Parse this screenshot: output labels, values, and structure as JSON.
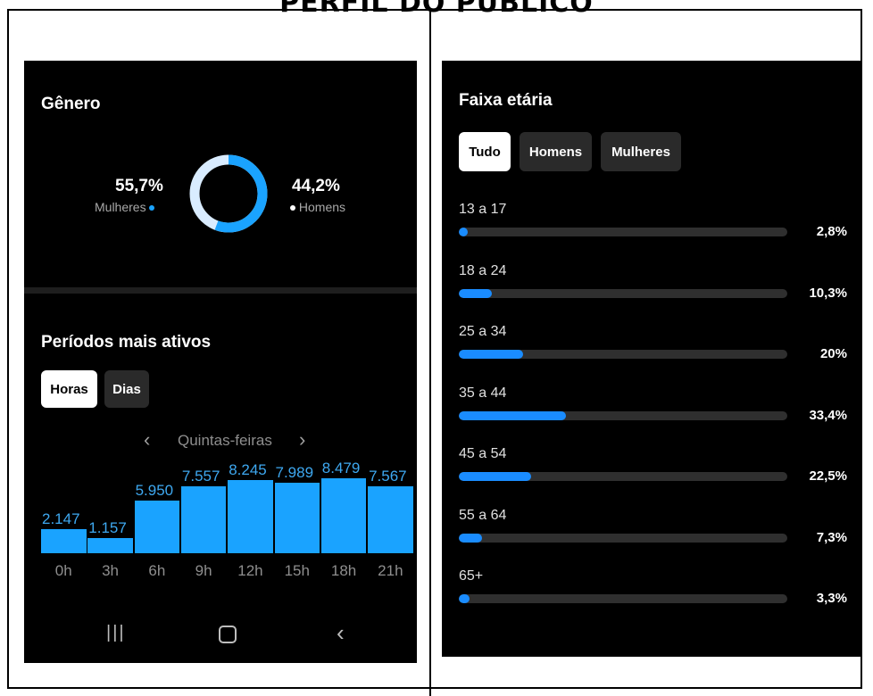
{
  "page_title": "PERFIL DO PÚBLICO",
  "left_panel": {
    "gender": {
      "title": "Gênero",
      "women_pct": "55,7%",
      "women_label": "Mulheres",
      "men_pct": "44,2%",
      "men_label": "Homens",
      "women_share": 55.7,
      "men_share": 44.2
    },
    "active_periods": {
      "title": "Períodos mais ativos",
      "tabs": [
        "Horas",
        "Dias"
      ],
      "active_tab": "Horas",
      "day_label": "Quintas-feiras",
      "prev_icon": "chevron-left-icon",
      "next_icon": "chevron-right-icon"
    },
    "sysnav": [
      "recent-apps-icon",
      "home-icon",
      "back-icon"
    ]
  },
  "right_panel": {
    "title": "Faixa etária",
    "tabs": [
      "Tudo",
      "Homens",
      "Mulheres"
    ],
    "active_tab": "Tudo",
    "rows": [
      {
        "label": "13 a 17",
        "pct": "2,8%",
        "value": 2.8
      },
      {
        "label": "18 a 24",
        "pct": "10,3%",
        "value": 10.3
      },
      {
        "label": "25 a 34",
        "pct": "20%",
        "value": 20
      },
      {
        "label": "35 a 44",
        "pct": "33,4%",
        "value": 33.4
      },
      {
        "label": "45 a 54",
        "pct": "22,5%",
        "value": 22.5
      },
      {
        "label": "55 a 64",
        "pct": "7,3%",
        "value": 7.3
      },
      {
        "label": "65+",
        "pct": "3,3%",
        "value": 3.3
      }
    ]
  },
  "colors": {
    "accent_blue": "#1aa3ff",
    "men_ring": "#d9ecff",
    "background": "#000000"
  },
  "chart_data": {
    "type": "bar",
    "categories": [
      "0h",
      "3h",
      "6h",
      "9h",
      "12h",
      "15h",
      "18h",
      "21h"
    ],
    "values": [
      2147,
      1157,
      5950,
      7557,
      8245,
      7989,
      8479,
      7567
    ],
    "value_labels": [
      "2.147",
      "1.157",
      "5.950",
      "7.557",
      "8.245",
      "7.989",
      "8.479",
      "7.567"
    ],
    "title": "",
    "xlabel": "",
    "ylabel": ""
  }
}
